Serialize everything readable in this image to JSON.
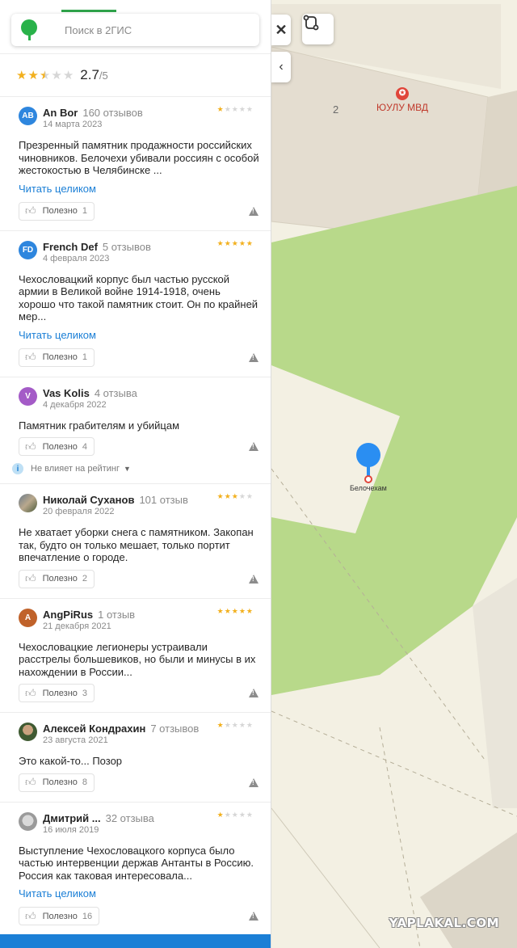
{
  "search": {
    "placeholder": "Поиск в 2ГИС"
  },
  "summary": {
    "rating": "2.7",
    "out_of": "/5",
    "stars": [
      "on",
      "on",
      "half",
      "off",
      "off"
    ]
  },
  "map": {
    "building_number": "2",
    "poi_name": "ЮУЛУ МВД",
    "poi_icon": "badge-icon",
    "pin_label": "Белочехам"
  },
  "reviews": [
    {
      "initials": "AB",
      "avatar_color": "#2e86de",
      "name": "An Bor",
      "count": "160 отзывов",
      "date": "14 марта 2023",
      "stars": [
        "on",
        "off",
        "off",
        "off",
        "off"
      ],
      "text": "Презренный памятник продажности российских чиновников. Белочехи убивали россиян с особой жестокостью в Челябинске ...",
      "more": "Читать целиком",
      "like_label": "Полезно",
      "likes": "1"
    },
    {
      "initials": "FD",
      "avatar_color": "#2e86de",
      "name": "French Def",
      "count": "5 отзывов",
      "date": "4 февраля 2023",
      "stars": [
        "on",
        "on",
        "on",
        "on",
        "on"
      ],
      "text": "Чехословацкий корпус был частью русской армии в Великой войне 1914-1918, очень хорошо что такой памятник стоит. Он по крайней мер...",
      "more": "Читать целиком",
      "like_label": "Полезно",
      "likes": "1"
    },
    {
      "initials": "V",
      "avatar_color": "#a45bc7",
      "name": "Vas Kolis",
      "count": "4 отзыва",
      "date": "4 декабря 2022",
      "stars": [],
      "text": "Памятник грабителям и убийцам",
      "like_label": "Полезно",
      "likes": "4",
      "note": "Не влияет на рейтинг"
    },
    {
      "initials": "",
      "avatar_style": "photo",
      "name": "Николай Суханов",
      "count": "101 отзыв",
      "date": "20 февраля 2022",
      "stars": [
        "on",
        "on",
        "on",
        "off",
        "off"
      ],
      "text": "Не хватает уборки снега с памятником. Закопан так, будто он только мешает, только портит впечатление о городе.",
      "like_label": "Полезно",
      "likes": "2"
    },
    {
      "initials": "A",
      "avatar_color": "#c0622a",
      "name": "AngPiRus",
      "count": "1 отзыв",
      "date": "21 декабря 2021",
      "stars": [
        "on",
        "on",
        "on",
        "on",
        "on"
      ],
      "text": "Чехословацкие легионеры устраивали расстрелы большевиков, но были и минусы в их нахождении в России...",
      "like_label": "Полезно",
      "likes": "3"
    },
    {
      "initials": "",
      "avatar_style": "photo2",
      "name": "Алексей Кондрахин",
      "count": "7 отзывов",
      "date": "23 августа 2021",
      "stars": [
        "on",
        "off",
        "off",
        "off",
        "off"
      ],
      "text": "Это какой-то... Позор",
      "like_label": "Полезно",
      "likes": "8"
    },
    {
      "initials": "",
      "avatar_style": "photo3",
      "name": "Дмитрий ...",
      "count": "32 отзыва",
      "date": "16 июля 2019",
      "stars": [
        "on",
        "off",
        "off",
        "off",
        "off"
      ],
      "text": "Выступление Чехословацкого корпуса было частью интервенции держав Антанты в Россию. Россия как таковая интересовала...",
      "more": "Читать целиком",
      "like_label": "Полезно",
      "likes": "16"
    }
  ],
  "watermark": "YAPLAKAL.COM",
  "colors": {
    "accent": "#1b7fd6",
    "star": "#f2b01e",
    "brand": "#29b24a",
    "park": "#b9da8c",
    "pin": "#2a8ef2"
  }
}
